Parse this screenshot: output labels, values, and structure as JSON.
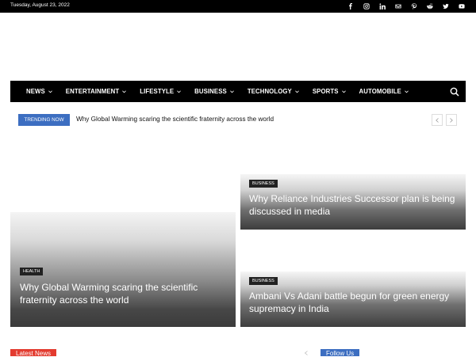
{
  "topbar": {
    "date": "Tuesday, August 23, 2022",
    "social_icons": [
      "facebook-icon",
      "instagram-icon",
      "linkedin-icon",
      "mail-icon",
      "pinterest-icon",
      "reddit-icon",
      "twitter-icon",
      "youtube-icon"
    ]
  },
  "nav": {
    "items": [
      {
        "label": "NEWS"
      },
      {
        "label": "ENTERTAINMENT"
      },
      {
        "label": "LIFESTYLE"
      },
      {
        "label": "BUSINESS"
      },
      {
        "label": "TECHNOLOGY"
      },
      {
        "label": "SPORTS"
      },
      {
        "label": "AUTOMOBILE"
      }
    ]
  },
  "trending": {
    "badge": "TRENDING NOW",
    "headline": "Why Global Warming scaring the scientific fraternity across the world"
  },
  "featured": [
    {
      "category": "HEALTH",
      "title": "Why Global Warming scaring the scientific fraternity across the world"
    },
    {
      "category": "BUSINESS",
      "title": "Why Reliance Industries Successor plan is being discussed in media"
    },
    {
      "category": "BUSINESS",
      "title": "Ambani Vs Adani battle begun for green energy supremacy in India"
    }
  ],
  "sections": {
    "latest_news": "Latest News",
    "follow_us": "Follow Us"
  },
  "colors": {
    "accent_blue": "#3c6ec1",
    "accent_red": "#e33b2f",
    "nav_bg": "#000000"
  }
}
